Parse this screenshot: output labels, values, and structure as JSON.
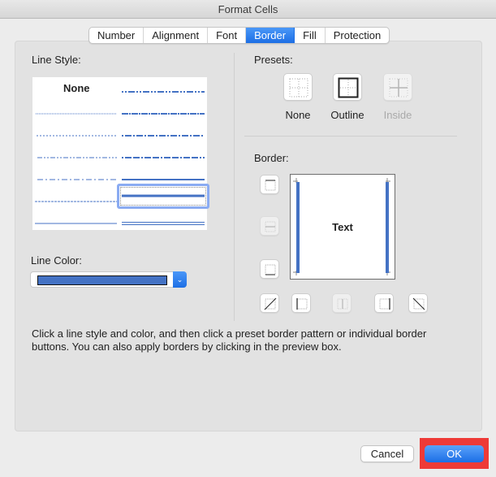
{
  "window": {
    "title": "Format Cells"
  },
  "tabs": [
    {
      "label": "Number",
      "active": false
    },
    {
      "label": "Alignment",
      "active": false
    },
    {
      "label": "Font",
      "active": false
    },
    {
      "label": "Border",
      "active": true
    },
    {
      "label": "Fill",
      "active": false
    },
    {
      "label": "Protection",
      "active": false
    }
  ],
  "line_style": {
    "label": "Line Style:",
    "none_label": "None",
    "selected": "medium-solid",
    "styles_left": [
      "none",
      "hair-dotted",
      "dotted",
      "dash-dot-dot",
      "dash-dot",
      "dashed",
      "thin-solid"
    ],
    "styles_right": [
      "medium-dash-dot-dot",
      "slanted-dash-dot",
      "medium-dash-dot",
      "medium-dashed",
      "medium-solid-thin",
      "medium-solid",
      "double"
    ]
  },
  "line_color": {
    "label": "Line Color:",
    "value": "#4472c4",
    "arrow": "chevron-down-icon"
  },
  "presets": {
    "label": "Presets:",
    "items": [
      {
        "label": "None",
        "enabled": true
      },
      {
        "label": "Outline",
        "enabled": true
      },
      {
        "label": "Inside",
        "enabled": false
      }
    ]
  },
  "border": {
    "label": "Border:",
    "preview_text": "Text",
    "line_color": "#4472c4",
    "buttons": [
      {
        "name": "top-border",
        "enabled": true
      },
      {
        "name": "middle-horizontal-border",
        "enabled": false
      },
      {
        "name": "bottom-border",
        "enabled": true
      },
      {
        "name": "diagonal-up-border",
        "enabled": true
      },
      {
        "name": "left-border",
        "enabled": true
      },
      {
        "name": "middle-vertical-border",
        "enabled": false
      },
      {
        "name": "right-border",
        "enabled": true
      },
      {
        "name": "diagonal-down-border",
        "enabled": true
      }
    ]
  },
  "help_text": "Click a line style and color, and then click a preset border pattern or individual border buttons. You can also apply borders by clicking in the preview box.",
  "footer": {
    "cancel_label": "Cancel",
    "ok_label": "OK"
  }
}
